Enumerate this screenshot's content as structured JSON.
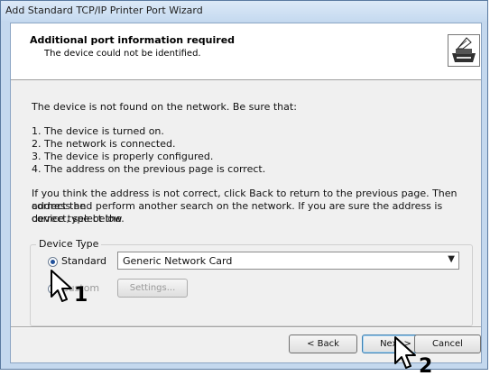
{
  "window": {
    "title": "Add Standard TCP/IP Printer Port Wizard"
  },
  "header": {
    "title": "Additional port information required",
    "subtitle": "The device could not be identified."
  },
  "intro": "The device is not found on the network.  Be sure that:",
  "checklist": [
    "1.  The device is turned on.",
    "2.  The network is connected.",
    "3.  The device is properly configured.",
    "4.  The address on the previous page is correct."
  ],
  "instructions_lines": [
    "If you think the address is not correct, click Back to return to the previous page.  Then correct the",
    "address and perform another search on the network.  If you are sure the address is correct, select the",
    "device type below."
  ],
  "device_type": {
    "legend": "Device Type",
    "standard_label": "Standard",
    "custom_label": "Custom",
    "selected": "Standard",
    "standard_value": "Generic Network Card",
    "settings_label": "Settings..."
  },
  "buttons": {
    "back": "< Back",
    "next": "Next >",
    "cancel": "Cancel"
  },
  "callouts": {
    "step1": "1",
    "step2": "2"
  },
  "icons": {
    "printer": "printer-icon",
    "cursor": "mouse-pointer-icon",
    "dropdown": "chevron-down-icon"
  }
}
